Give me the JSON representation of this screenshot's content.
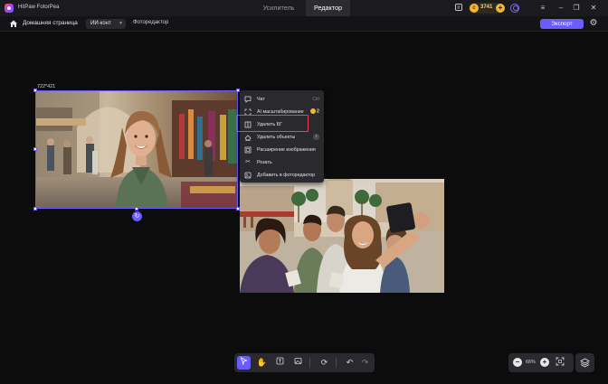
{
  "app": {
    "title": "HitPaw FotorPea"
  },
  "mode_tabs": [
    {
      "label": "Усилитель",
      "active": false
    },
    {
      "label": "Редактор",
      "active": true
    }
  ],
  "titlebar": {
    "credits": "3741",
    "icons": [
      "feedback-icon",
      "coin-icon",
      "plus-icon",
      "user-icon",
      "menu-icon",
      "minimize-icon",
      "restore-icon",
      "close-icon"
    ]
  },
  "nav": {
    "home_label": "Домашняя страница",
    "ai_pill_label": "ИИ-конт",
    "editor_label": "Фоторедактор",
    "export_label": "Экспорт"
  },
  "canvas": {
    "image1_size_label": "722*421"
  },
  "context_menu": {
    "items": [
      {
        "label": "Чат",
        "icon": "chat-icon",
        "shortcut": "Ctrl"
      },
      {
        "label": "AI масштабирование",
        "icon": "upscale-icon",
        "badge": "2"
      },
      {
        "label": "Удалить БГ",
        "icon": "remove-bg-icon",
        "highlighted": true
      },
      {
        "label": "Удалить объекты",
        "icon": "eraser-icon",
        "chevron": "›"
      },
      {
        "label": "Расширение изображения",
        "icon": "expand-icon"
      },
      {
        "label": "Резать",
        "icon": "scissors-icon"
      },
      {
        "label": "Добавить в фоторедактор",
        "icon": "add-to-editor-icon"
      }
    ]
  },
  "bottom_toolbar": {
    "tools": [
      "select-tool-icon",
      "hand-tool-icon",
      "text-tool-icon",
      "image-tool-icon",
      "rotate-tool-icon",
      "undo-icon",
      "redo-icon"
    ],
    "active_tool": "select-tool-icon"
  },
  "zoom": {
    "value": "66%"
  },
  "colors": {
    "accent": "#6c5cff",
    "highlight": "#ff3b4f",
    "background": "#0c0c0d",
    "panel": "#2a2a2e"
  }
}
